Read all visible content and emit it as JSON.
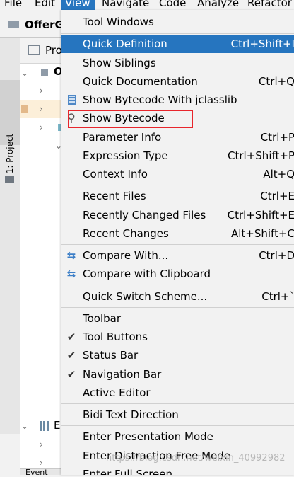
{
  "menubar": {
    "items": [
      {
        "label": "File",
        "active": false
      },
      {
        "label": "Edit",
        "active": false
      },
      {
        "label": "View",
        "active": true
      },
      {
        "label": "Navigate",
        "active": false
      },
      {
        "label": "Code",
        "active": false
      },
      {
        "label": "Analyze",
        "active": false
      },
      {
        "label": "Refactor",
        "active": false
      }
    ]
  },
  "navbar": {
    "project_name": "OfferG"
  },
  "tool_strip": {
    "project_label": "1: Project"
  },
  "project_panel": {
    "header_label": "Pro",
    "bottom_label": "Event",
    "tree_letter_root": "O",
    "tree_letter_ext": "E"
  },
  "view_menu": {
    "items": [
      {
        "label": "Tool Windows",
        "shortcut": "",
        "icon": "",
        "highlighted": false
      },
      {
        "label": "Quick Definition",
        "shortcut": "Ctrl+Shift+I",
        "icon": "",
        "highlighted": true
      },
      {
        "label": "Show Siblings",
        "shortcut": "",
        "icon": "",
        "highlighted": false
      },
      {
        "label": "Quick Documentation",
        "shortcut": "Ctrl+Q",
        "icon": "",
        "highlighted": false
      },
      {
        "label": "Show Bytecode With jclasslib",
        "shortcut": "",
        "icon": "jclasslib-icon",
        "highlighted": false
      },
      {
        "label": "Show Bytecode",
        "shortcut": "",
        "icon": "bytecode-icon",
        "highlighted": false
      },
      {
        "label": "Parameter Info",
        "shortcut": "Ctrl+P",
        "icon": "",
        "highlighted": false
      },
      {
        "label": "Expression Type",
        "shortcut": "Ctrl+Shift+P",
        "icon": "",
        "highlighted": false
      },
      {
        "label": "Context Info",
        "shortcut": "Alt+Q",
        "icon": "",
        "highlighted": false
      },
      {
        "label": "Recent Files",
        "shortcut": "Ctrl+E",
        "icon": "",
        "highlighted": false
      },
      {
        "label": "Recently Changed Files",
        "shortcut": "Ctrl+Shift+E",
        "icon": "",
        "highlighted": false
      },
      {
        "label": "Recent Changes",
        "shortcut": "Alt+Shift+C",
        "icon": "",
        "highlighted": false
      },
      {
        "label": "Compare With...",
        "shortcut": "Ctrl+D",
        "icon": "compare-arrows-icon",
        "highlighted": false
      },
      {
        "label": "Compare with Clipboard",
        "shortcut": "",
        "icon": "compare-clipboard-icon",
        "highlighted": false
      },
      {
        "label": "Quick Switch Scheme...",
        "shortcut": "Ctrl+`",
        "icon": "",
        "highlighted": false
      },
      {
        "label": "Toolbar",
        "shortcut": "",
        "icon": "",
        "highlighted": false
      },
      {
        "label": "Tool Buttons",
        "shortcut": "",
        "icon": "checkmark-icon",
        "highlighted": false
      },
      {
        "label": "Status Bar",
        "shortcut": "",
        "icon": "checkmark-icon",
        "highlighted": false
      },
      {
        "label": "Navigation Bar",
        "shortcut": "",
        "icon": "checkmark-icon",
        "highlighted": false
      },
      {
        "label": "Active Editor",
        "shortcut": "",
        "icon": "",
        "highlighted": false
      },
      {
        "label": "Bidi Text Direction",
        "shortcut": "",
        "icon": "",
        "highlighted": false
      },
      {
        "label": "Enter Presentation Mode",
        "shortcut": "",
        "icon": "",
        "highlighted": false
      },
      {
        "label": "Enter Distraction Free Mode",
        "shortcut": "",
        "icon": "",
        "highlighted": false
      },
      {
        "label": "Enter Full Screen",
        "shortcut": "",
        "icon": "",
        "highlighted": false
      }
    ]
  },
  "watermark": "https://blog.csdn.net/weixin_40992982",
  "colors": {
    "highlight": "#2675bf",
    "annotation_box": "#e8262c",
    "menu_bg": "#f2f2f2"
  }
}
